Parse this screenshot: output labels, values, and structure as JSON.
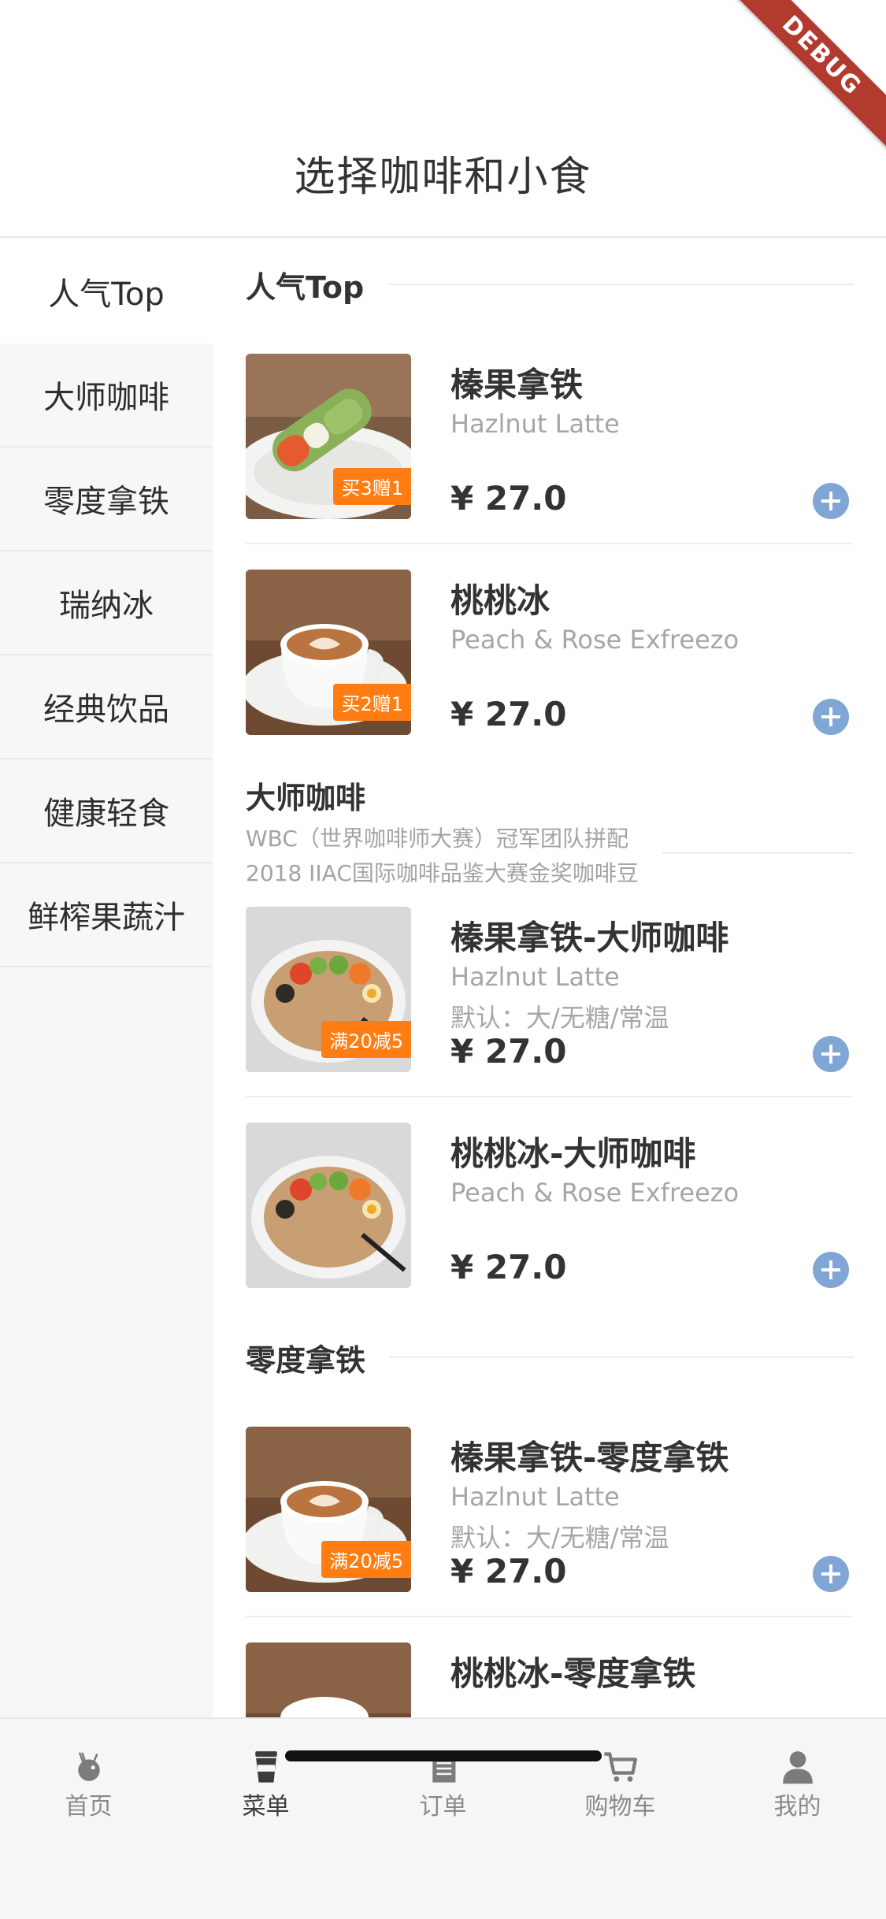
{
  "header": {
    "title": "选择咖啡和小食"
  },
  "debug_banner": {
    "label": "DEBUG"
  },
  "sidebar": {
    "items": [
      {
        "label": "人气Top",
        "active": true
      },
      {
        "label": "大师咖啡",
        "active": false
      },
      {
        "label": "零度拿铁",
        "active": false
      },
      {
        "label": "瑞纳冰",
        "active": false
      },
      {
        "label": "经典饮品",
        "active": false
      },
      {
        "label": "健康轻食",
        "active": false
      },
      {
        "label": "鲜榨果蔬汁",
        "active": false
      }
    ]
  },
  "sections": [
    {
      "title": "人气Top",
      "products": [
        {
          "name": "榛果拿铁",
          "en": "Hazlnut Latte",
          "price": "¥ 27.0",
          "promo": "买3赠1",
          "image": "wrap-food"
        },
        {
          "name": "桃桃冰",
          "en": "Peach & Rose Exfreezo",
          "price": "¥ 27.0",
          "promo": "买2赠1",
          "image": "latte-cup"
        }
      ]
    },
    {
      "title": "大师咖啡",
      "desc1": "WBC（世界咖啡师大赛）冠军团队拼配",
      "desc2": "2018 IIAC国际咖啡品鉴大赛金奖咖啡豆",
      "products": [
        {
          "name": "榛果拿铁-大师咖啡",
          "en": "Hazlnut Latte",
          "default": "默认：大/无糖/常温",
          "price": "¥ 27.0",
          "promo": "满20减5",
          "image": "salad-bowl"
        },
        {
          "name": "桃桃冰-大师咖啡",
          "en": "Peach & Rose Exfreezo",
          "price": "¥ 27.0",
          "image": "salad-bowl"
        }
      ]
    },
    {
      "title": "零度拿铁",
      "products": [
        {
          "name": "榛果拿铁-零度拿铁",
          "en": "Hazlnut Latte",
          "default": "默认：大/无糖/常温",
          "price": "¥ 27.0",
          "promo": "满20减5",
          "image": "latte-cup"
        },
        {
          "name": "桃桃冰-零度拿铁",
          "image": "latte-cup"
        }
      ]
    }
  ],
  "bottom_nav": {
    "items": [
      {
        "label": "首页",
        "icon": "deer-logo-icon",
        "active": false
      },
      {
        "label": "菜单",
        "icon": "coffee-cup-icon",
        "active": true
      },
      {
        "label": "订单",
        "icon": "document-icon",
        "active": false
      },
      {
        "label": "购物车",
        "icon": "cart-icon",
        "active": false
      },
      {
        "label": "我的",
        "icon": "user-icon",
        "active": false
      }
    ]
  },
  "colors": {
    "promo": "#ff7d12",
    "add_button": "#7fa6d4",
    "sidebar_bg": "#f6f8f7",
    "debug_ribbon": "#b33a2e"
  }
}
